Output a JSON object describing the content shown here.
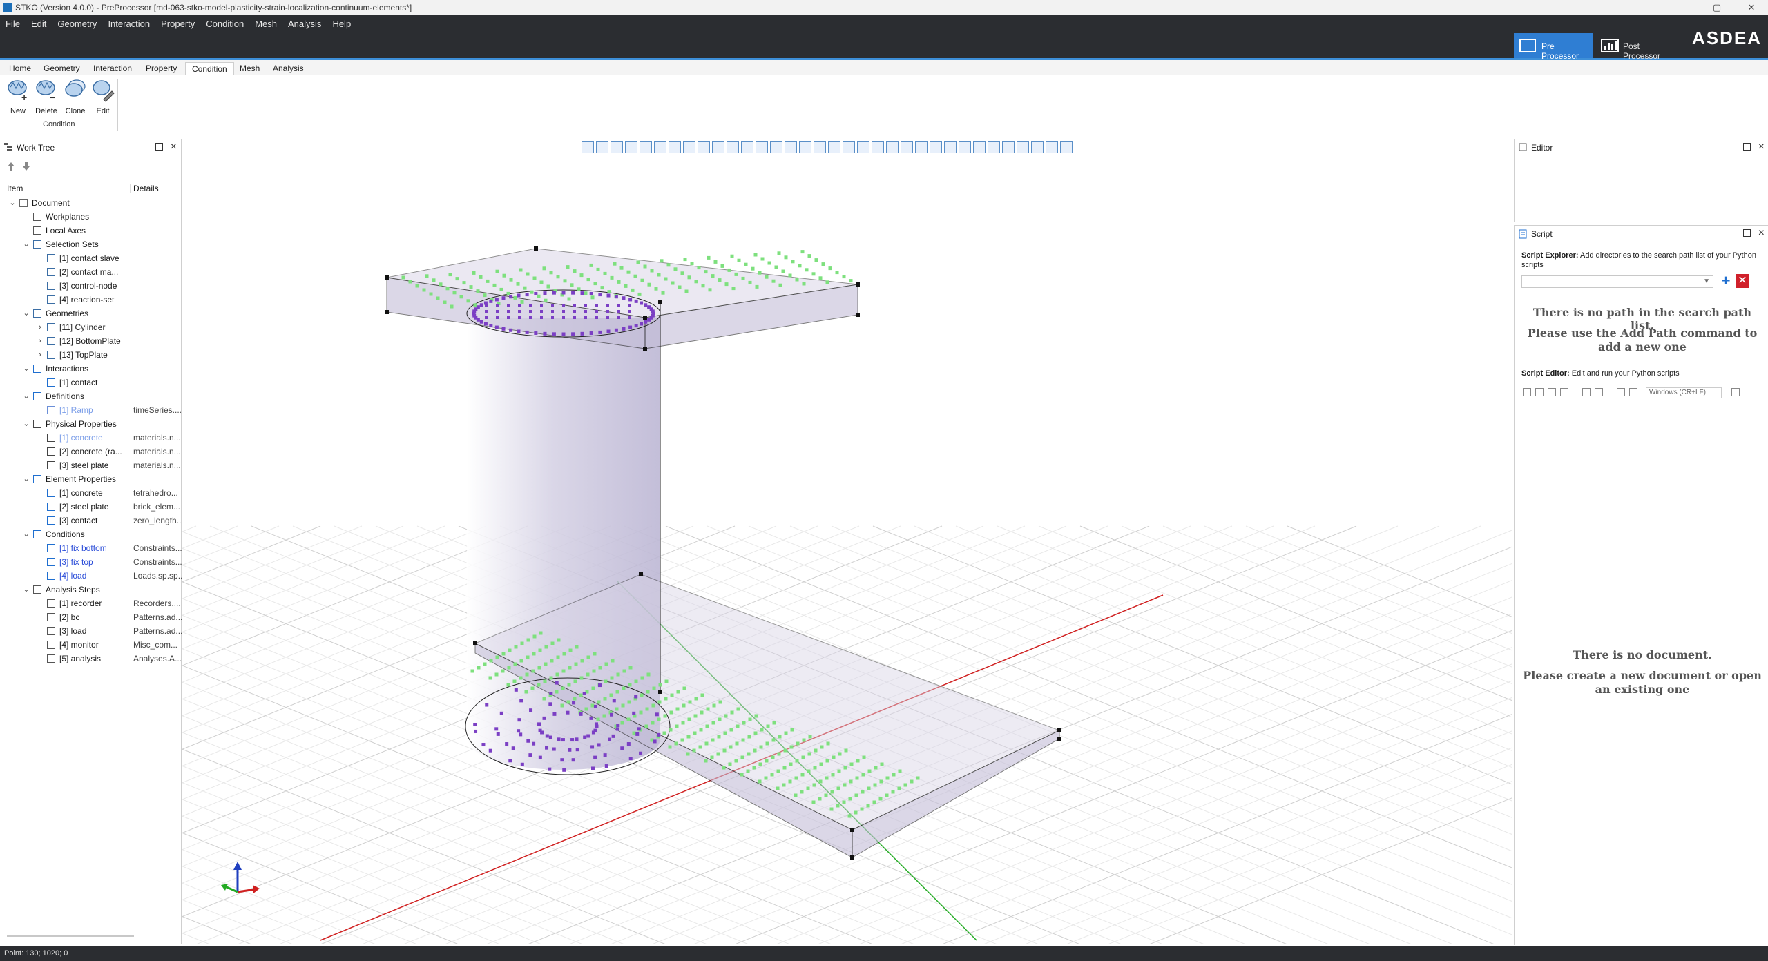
{
  "window": {
    "title": "STKO (Version 4.0.0) - PreProcessor [md-063-stko-model-plasticity-strain-localization-continuum-elements*]",
    "controls": [
      "—",
      "▢",
      "✕"
    ]
  },
  "menu": [
    "File",
    "Edit",
    "Geometry",
    "Interaction",
    "Property",
    "Condition",
    "Mesh",
    "Analysis",
    "Help"
  ],
  "modes": {
    "pre": "Pre Processor",
    "post": "Post Processor"
  },
  "brand": "ASDEA",
  "ribbon": {
    "tabs": [
      "Home",
      "Geometry",
      "Interaction",
      "Property",
      "Condition",
      "Mesh",
      "Analysis"
    ],
    "active_tab": "Condition",
    "buttons": [
      "New",
      "Delete",
      "Clone",
      "Edit"
    ],
    "group_label": "Condition"
  },
  "worktree": {
    "title": "Work Tree",
    "col_item": "Item",
    "col_details": "Details",
    "rows": [
      {
        "label": "Document",
        "details": "",
        "style": ""
      },
      {
        "label": "Workplanes",
        "details": "",
        "style": ""
      },
      {
        "label": "Local Axes",
        "details": "",
        "style": ""
      },
      {
        "label": "Selection Sets",
        "details": "",
        "style": ""
      },
      {
        "label": "[1] contact slave",
        "details": "",
        "style": ""
      },
      {
        "label": "[2] contact ma...",
        "details": "",
        "style": ""
      },
      {
        "label": "[3] control-node",
        "details": "",
        "style": ""
      },
      {
        "label": "[4] reaction-set",
        "details": "",
        "style": ""
      },
      {
        "label": "Geometries",
        "details": "",
        "style": ""
      },
      {
        "label": "[11] Cylinder",
        "details": "",
        "style": ""
      },
      {
        "label": "[12] BottomPlate",
        "details": "",
        "style": ""
      },
      {
        "label": "[13] TopPlate",
        "details": "",
        "style": ""
      },
      {
        "label": "Interactions",
        "details": "",
        "style": ""
      },
      {
        "label": "[1] contact",
        "details": "",
        "style": ""
      },
      {
        "label": "Definitions",
        "details": "",
        "style": ""
      },
      {
        "label": "[1] Ramp",
        "details": "timeSeries....",
        "style": "light"
      },
      {
        "label": "Physical Properties",
        "details": "",
        "style": ""
      },
      {
        "label": "[1] concrete",
        "details": "materials.n...",
        "style": "light"
      },
      {
        "label": "[2] concrete (ra...",
        "details": "materials.n...",
        "style": ""
      },
      {
        "label": "[3] steel plate",
        "details": "materials.n...",
        "style": ""
      },
      {
        "label": "Element Properties",
        "details": "",
        "style": ""
      },
      {
        "label": "[1] concrete",
        "details": "tetrahedro...",
        "style": ""
      },
      {
        "label": "[2] steel plate",
        "details": "brick_elem...",
        "style": ""
      },
      {
        "label": "[3] contact",
        "details": "zero_length...",
        "style": ""
      },
      {
        "label": "Conditions",
        "details": "",
        "style": ""
      },
      {
        "label": "[1] fix bottom",
        "details": "Constraints....",
        "style": "blue"
      },
      {
        "label": "[3] fix top",
        "details": "Constraints....",
        "style": "blue"
      },
      {
        "label": "[4] load",
        "details": "Loads.sp.sp....",
        "style": "blue"
      },
      {
        "label": "Analysis Steps",
        "details": "",
        "style": ""
      },
      {
        "label": "[1] recorder",
        "details": "Recorders....",
        "style": ""
      },
      {
        "label": "[2] bc",
        "details": "Patterns.ad...",
        "style": ""
      },
      {
        "label": "[3] load",
        "details": "Patterns.ad...",
        "style": ""
      },
      {
        "label": "[4] monitor",
        "details": "Misc_com...",
        "style": ""
      },
      {
        "label": "[5] analysis",
        "details": "Analyses.A...",
        "style": ""
      }
    ]
  },
  "editor": {
    "title": "Editor"
  },
  "script": {
    "title": "Script",
    "explorer_label": "Script Explorer:",
    "explorer_desc": "Add directories to the search path list of your Python scripts",
    "no_path": "There is no path in the search path list.",
    "add_path_hint": "Please use the Add Path command to add a new one",
    "editor_label": "Script Editor:",
    "editor_desc": "Edit and run your Python scripts",
    "line_ending": "Windows (CR+LF)",
    "no_doc": "There is no document.",
    "no_doc_hint": "Please create a new document or open an existing one"
  },
  "status": "Point: 130; 1020; 0",
  "colors": {
    "menubar": "#2b2d31",
    "accent": "#2f7ed3",
    "model_fill": "#cfcae0",
    "node_purple": "#7b3fc4",
    "node_green": "#7ee07e"
  }
}
